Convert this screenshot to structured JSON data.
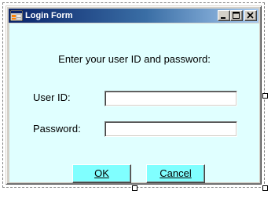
{
  "window": {
    "title": "Login Form",
    "minimize_icon": "minimize-icon",
    "maximize_icon": "maximize-icon",
    "close_icon": "close-icon",
    "app_icon": "form-app-icon"
  },
  "form": {
    "instruction": "Enter your user ID and password:",
    "user_id_label": "User ID:",
    "user_id_value": "",
    "password_label": "Password:",
    "password_value": "",
    "ok_label": "OK",
    "cancel_label": "Cancel"
  },
  "colors": {
    "client_background": "#e0ffff",
    "button_background": "#80ffff",
    "titlebar_start": "#0a246a",
    "titlebar_end": "#a6caf0"
  }
}
